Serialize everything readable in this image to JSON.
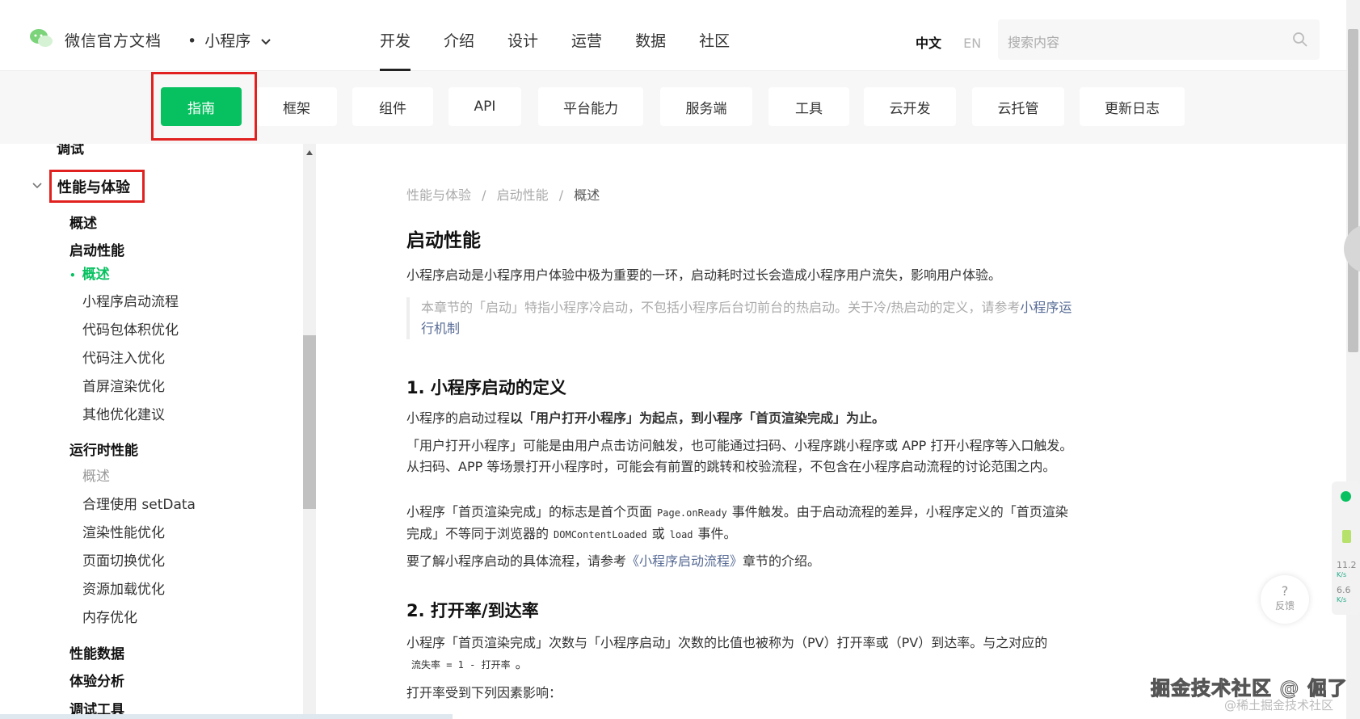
{
  "header": {
    "brand": "微信官方文档",
    "product": "小程序",
    "nav": [
      "开发",
      "介绍",
      "设计",
      "运营",
      "数据",
      "社区"
    ],
    "nav_active": "开发",
    "lang_zh": "中文",
    "lang_en": "EN",
    "search_placeholder": "搜索内容"
  },
  "subnav": {
    "tabs": [
      "指南",
      "框架",
      "组件",
      "API",
      "平台能力",
      "服务端",
      "工具",
      "云开发",
      "云托管",
      "更新日志"
    ],
    "active": "指南"
  },
  "sidebar": {
    "prev_item": "调试",
    "section": "性能与体验",
    "items": [
      {
        "label": "概述",
        "level": 1
      },
      {
        "label": "启动性能",
        "level": 1
      },
      {
        "label": "概述",
        "level": 2,
        "state": "current"
      },
      {
        "label": "小程序启动流程",
        "level": 2
      },
      {
        "label": "代码包体积优化",
        "level": 2
      },
      {
        "label": "代码注入优化",
        "level": 2
      },
      {
        "label": "首屏渲染优化",
        "level": 2
      },
      {
        "label": "其他优化建议",
        "level": 2
      },
      {
        "label": "运行时性能",
        "level": 1
      },
      {
        "label": "概述",
        "level": 2,
        "state": "muted"
      },
      {
        "label": "合理使用 setData",
        "level": 2
      },
      {
        "label": "渲染性能优化",
        "level": 2
      },
      {
        "label": "页面切换优化",
        "level": 2
      },
      {
        "label": "资源加载优化",
        "level": 2
      },
      {
        "label": "内存优化",
        "level": 2
      },
      {
        "label": "性能数据",
        "level": 1
      },
      {
        "label": "体验分析",
        "level": 1
      },
      {
        "label": "调试工具",
        "level": 1
      }
    ]
  },
  "content": {
    "breadcrumb": [
      "性能与体验",
      "启动性能",
      "概述"
    ],
    "title": "启动性能",
    "intro": "小程序启动是小程序用户体验中极为重要的一环，启动耗时过长会造成小程序用户流失，影响用户体验。",
    "note_text": "本章节的「启动」特指小程序冷启动，不包括小程序后台切前台的热启动。关于冷/热启动的定义，请参考",
    "note_link": "小程序运行机制",
    "s1_title": "1. 小程序启动的定义",
    "s1_p1_a": "小程序的启动过程",
    "s1_p1_b": "以「用户打开小程序」为起点，到小程序「首页渲染完成」为止。",
    "s1_p2": "「用户打开小程序」可能是由用户点击访问触发，也可能通过扫码、小程序跳小程序或 APP 打开小程序等入口触发。从扫码、APP 等场景打开小程序时，可能会有前置的跳转和校验流程，不包含在小程序启动流程的讨论范围之内。",
    "s1_p3_a": "小程序「首页渲染完成」的标志是首个页面",
    "s1_p3_code1": "Page.onReady",
    "s1_p3_b": "事件触发。由于启动流程的差异，小程序定义的「首页渲染完成」不等同于浏览器的",
    "s1_p3_code2": "DOMContentLoaded",
    "s1_p3_or": "或",
    "s1_p3_code3": "load",
    "s1_p3_c": "事件。",
    "s1_p4_a": "要了解小程序启动的具体流程，请参考",
    "s1_p4_link": "《小程序启动流程》",
    "s1_p4_b": "章节的介绍。",
    "s2_title": "2. 打开率/到达率",
    "s2_p1": "小程序「首页渲染完成」次数与「小程序启动」次数的比值也被称为（PV）打开率或（PV）到达率。与之对应的",
    "s2_code": "流失率 = 1 - 打开率",
    "s2_code_end": "。",
    "s2_p2": "打开率受到下列因素影响："
  },
  "widgets": {
    "feedback_icon": "?",
    "feedback_label": "反馈",
    "net_up": "11.2",
    "net_up_unit": "K/s",
    "net_down": "6.6",
    "net_down_unit": "K/s"
  },
  "watermark": {
    "main": "掘金技术社区 @ 倔了",
    "sub": "@稀土掘金技术社区"
  },
  "colors": {
    "accent": "#07c160",
    "highlight": "#e0211f",
    "link": "#576b95"
  }
}
